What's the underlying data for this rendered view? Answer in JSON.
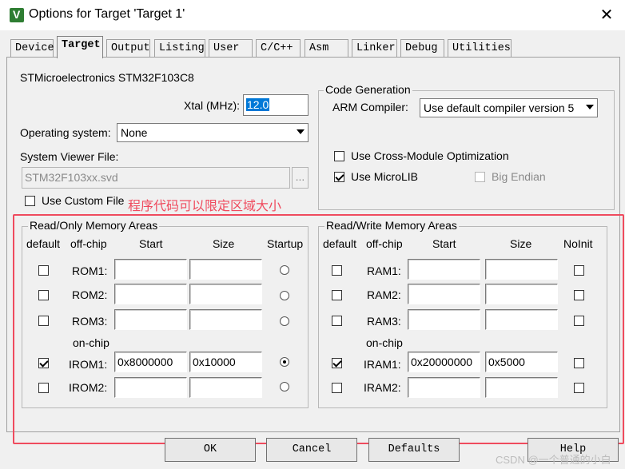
{
  "window": {
    "title": "Options for Target 'Target 1'",
    "close_glyph": "✕",
    "icon_letter": "V"
  },
  "tabs": [
    "Device",
    "Target",
    "Output",
    "Listing",
    "User",
    "C/C++",
    "Asm",
    "Linker",
    "Debug",
    "Utilities"
  ],
  "device_name": "STMicroelectronics STM32F103C8",
  "xtal": {
    "label": "Xtal (MHz):",
    "value": "12.0"
  },
  "os": {
    "label": "Operating system:",
    "value": "None"
  },
  "svd": {
    "label": "System Viewer File:",
    "value": "STM32F103xx.svd",
    "browse": "..."
  },
  "custom_file": {
    "label": "Use Custom File",
    "checked": false
  },
  "code_gen": {
    "title": "Code Generation",
    "compiler_label": "ARM Compiler:",
    "compiler_value": "Use default compiler version 5",
    "cross_module": {
      "label": "Use Cross-Module Optimization",
      "checked": false
    },
    "microlib": {
      "label": "Use MicroLIB",
      "checked": true
    },
    "big_endian": {
      "label": "Big Endian",
      "checked": false
    }
  },
  "annotation": "程序代码可以限定区域大小",
  "ro": {
    "title": "Read/Only Memory Areas",
    "headers": {
      "default": "default",
      "offchip": "off-chip",
      "start": "Start",
      "size": "Size",
      "startup": "Startup"
    },
    "onchip_label": "on-chip",
    "rows": [
      {
        "name": "ROM1:",
        "start": "",
        "size": "",
        "default": false,
        "startup": false
      },
      {
        "name": "ROM2:",
        "start": "",
        "size": "",
        "default": false,
        "startup": false
      },
      {
        "name": "ROM3:",
        "start": "",
        "size": "",
        "default": false,
        "startup": false
      },
      {
        "name": "IROM1:",
        "start": "0x8000000",
        "size": "0x10000",
        "default": true,
        "startup": true
      },
      {
        "name": "IROM2:",
        "start": "",
        "size": "",
        "default": false,
        "startup": false
      }
    ]
  },
  "rw": {
    "title": "Read/Write Memory Areas",
    "headers": {
      "default": "default",
      "offchip": "off-chip",
      "start": "Start",
      "size": "Size",
      "noinit": "NoInit"
    },
    "onchip_label": "on-chip",
    "rows": [
      {
        "name": "RAM1:",
        "start": "",
        "size": "",
        "default": false,
        "noinit": false
      },
      {
        "name": "RAM2:",
        "start": "",
        "size": "",
        "default": false,
        "noinit": false
      },
      {
        "name": "RAM3:",
        "start": "",
        "size": "",
        "default": false,
        "noinit": false
      },
      {
        "name": "IRAM1:",
        "start": "0x20000000",
        "size": "0x5000",
        "default": true,
        "noinit": false
      },
      {
        "name": "IRAM2:",
        "start": "",
        "size": "",
        "default": false,
        "noinit": false
      }
    ]
  },
  "buttons": {
    "ok": "OK",
    "cancel": "Cancel",
    "defaults": "Defaults",
    "help": "Help"
  },
  "watermark": "CSDN @一个普通的小白",
  "colors": {
    "annotation": "#ef4b5e",
    "selection": "#0078d7"
  }
}
